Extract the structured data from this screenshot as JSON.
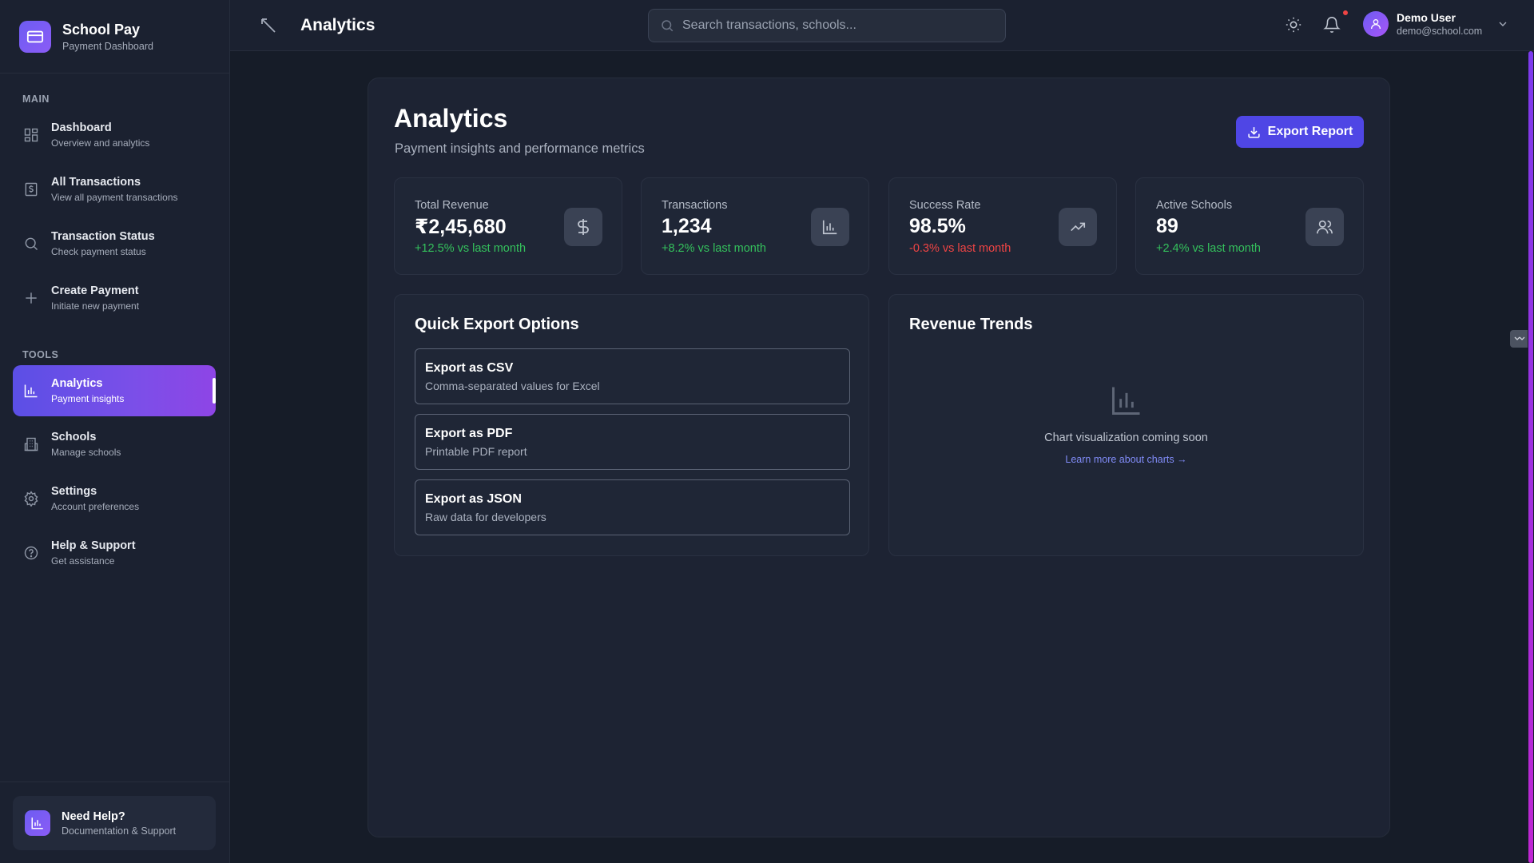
{
  "brand": {
    "title": "School Pay",
    "subtitle": "Payment Dashboard"
  },
  "sidebar": {
    "main_label": "MAIN",
    "tools_label": "TOOLS",
    "items": [
      {
        "label": "Dashboard",
        "sub": "Overview and analytics",
        "icon": "grid-icon"
      },
      {
        "label": "All Transactions",
        "sub": "View all payment transactions",
        "icon": "receipt-icon"
      },
      {
        "label": "Transaction Status",
        "sub": "Check payment status",
        "icon": "search-icon"
      },
      {
        "label": "Create Payment",
        "sub": "Initiate new payment",
        "icon": "plus-icon"
      },
      {
        "label": "Analytics",
        "sub": "Payment insights",
        "icon": "bar-chart-icon",
        "active": true
      },
      {
        "label": "Schools",
        "sub": "Manage schools",
        "icon": "building-icon"
      },
      {
        "label": "Settings",
        "sub": "Account preferences",
        "icon": "gear-icon"
      },
      {
        "label": "Help & Support",
        "sub": "Get assistance",
        "icon": "help-circle-icon"
      }
    ],
    "help_card": {
      "title": "Need Help?",
      "subtitle": "Documentation & Support"
    }
  },
  "topbar": {
    "title": "Analytics",
    "search_placeholder": "Search transactions, schools...",
    "user": {
      "name": "Demo User",
      "email": "demo@school.com"
    }
  },
  "page": {
    "title": "Analytics",
    "subtitle": "Payment insights and performance metrics",
    "export_button": "Export Report"
  },
  "stats": [
    {
      "label": "Total Revenue",
      "value": "₹2,45,680",
      "change": "+12.5% vs last month",
      "trend": "up",
      "icon": "dollar-icon"
    },
    {
      "label": "Transactions",
      "value": "1,234",
      "change": "+8.2% vs last month",
      "trend": "up",
      "icon": "bar-chart-icon"
    },
    {
      "label": "Success Rate",
      "value": "98.5%",
      "change": "-0.3% vs last month",
      "trend": "down",
      "icon": "trending-up-icon"
    },
    {
      "label": "Active Schools",
      "value": "89",
      "change": "+2.4% vs last month",
      "trend": "up",
      "icon": "users-icon"
    }
  ],
  "quick_export": {
    "title": "Quick Export Options",
    "options": [
      {
        "title": "Export as CSV",
        "desc": "Comma-separated values for Excel"
      },
      {
        "title": "Export as PDF",
        "desc": "Printable PDF report"
      },
      {
        "title": "Export as JSON",
        "desc": "Raw data for developers"
      }
    ]
  },
  "revenue_trends": {
    "title": "Revenue Trends",
    "placeholder_text": "Chart visualization coming soon",
    "link_text": "Learn more about charts →"
  },
  "colors": {
    "accent": "#4f46e5",
    "positive": "#34c15c",
    "negative": "#ef4444",
    "background": "#161c28"
  }
}
